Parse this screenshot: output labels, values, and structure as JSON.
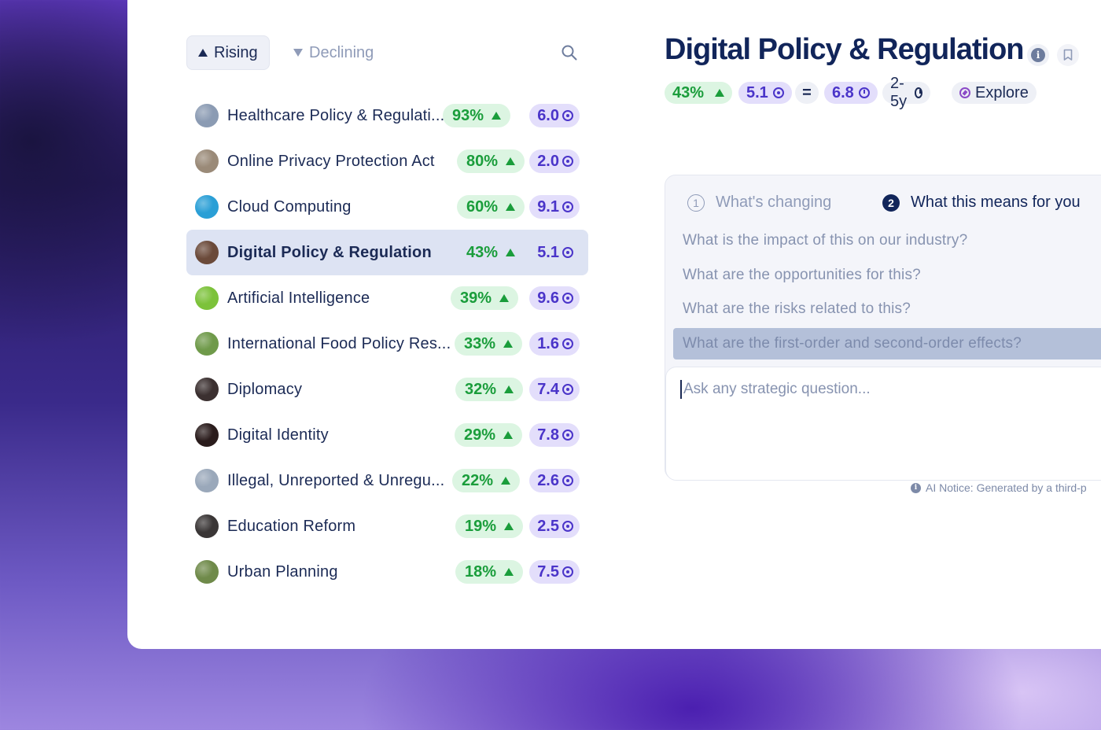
{
  "filters": {
    "rising_label": "Rising",
    "declining_label": "Declining"
  },
  "topics": [
    {
      "label": "Healthcare Policy & Regulati...",
      "growth": "93%",
      "score": "6.0",
      "avatar_color": "#8b9bb3"
    },
    {
      "label": "Online Privacy Protection Act",
      "growth": "80%",
      "score": "2.0",
      "avatar_color": "#9a8a78"
    },
    {
      "label": "Cloud Computing",
      "growth": "60%",
      "score": "9.1",
      "avatar_color": "#2a9fd6"
    },
    {
      "label": "Digital Policy & Regulation",
      "growth": "43%",
      "score": "5.1",
      "avatar_color": "#6b4a3a"
    },
    {
      "label": "Artificial Intelligence",
      "growth": "39%",
      "score": "9.6",
      "avatar_color": "#7cc23a"
    },
    {
      "label": "International Food Policy Res...",
      "growth": "33%",
      "score": "1.6",
      "avatar_color": "#6f9a4a"
    },
    {
      "label": "Diplomacy",
      "growth": "32%",
      "score": "7.4",
      "avatar_color": "#3b3030"
    },
    {
      "label": "Digital Identity",
      "growth": "29%",
      "score": "7.8",
      "avatar_color": "#2a1c1c"
    },
    {
      "label": "Illegal, Unreported & Unregu...",
      "growth": "22%",
      "score": "2.6",
      "avatar_color": "#9aa8ba"
    },
    {
      "label": "Education Reform",
      "growth": "19%",
      "score": "2.5",
      "avatar_color": "#3a3636"
    },
    {
      "label": "Urban Planning",
      "growth": "18%",
      "score": "7.5",
      "avatar_color": "#6f8a4a"
    }
  ],
  "selected_index": 3,
  "detail": {
    "title": "Digital Policy & Regulation",
    "growth": "43%",
    "score": "5.1",
    "equals": "=",
    "score2": "6.8",
    "horizon": "2-5y",
    "explore_label": "Explore"
  },
  "qa": {
    "tab1_num": "1",
    "tab1_label": "What's changing",
    "tab2_num": "2",
    "tab2_label": "What this means for you",
    "questions": [
      "What is the impact of this on our industry?",
      "What are the opportunities for this?",
      "What are the risks related to this?",
      "What are the first-order and second-order effects?"
    ],
    "selected_question": 3,
    "ask_placeholder": "Ask any strategic question..."
  },
  "notice": "AI Notice: Generated by a third-p",
  "colors": {
    "accent_green": "#1a9d3b",
    "accent_purple": "#4a34c9",
    "navy": "#11255a"
  }
}
